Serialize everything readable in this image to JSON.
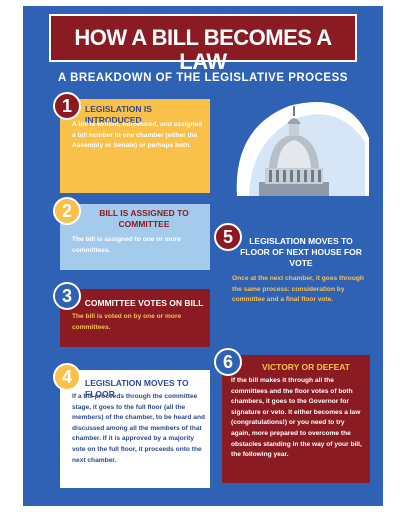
{
  "header": {
    "title": "HOW A BILL BECOMES A LAW",
    "subtitle": "A BREAKDOWN OF THE LEGISLATIVE PROCESS"
  },
  "colors": {
    "background_blue": "#2f62b4",
    "dark_red": "#8b1b23",
    "yellow": "#f9c04a",
    "light_blue": "#a4cbeb",
    "white": "#ffffff",
    "text_blue": "#2b4a93"
  },
  "steps": [
    {
      "number": "1",
      "heading": "LEGISLATION IS INTRODUCED",
      "text": "A bill is written, introduced, and assigned a bill number in one chamber (either the Assembly or Senate) or perhaps both."
    },
    {
      "number": "2",
      "heading": "BILL IS ASSIGNED TO COMMITTEE",
      "text": "The bill is assigned to one or more committees."
    },
    {
      "number": "3",
      "heading": "COMMITTEE VOTES ON BILL",
      "text": "The bill is voted on by one or more committees."
    },
    {
      "number": "4",
      "heading": "LEGISLATION MOVES TO FLOOR",
      "text": "If a bill proceeds through the committee stage, it goes to the full floor (all the members) of the chamber, to be heard and discussed among all the members of that chamber. If it is approved by a majority vote on the full floor, it proceeds onto the next chamber."
    },
    {
      "number": "5",
      "heading": "LEGISLATION MOVES TO FLOOR OF NEXT HOUSE FOR VOTE",
      "text": "Once at the next chamber, it goes through the same process: consideration by committee and a final floor vote."
    },
    {
      "number": "6",
      "heading": "VICTORY OR DEFEAT",
      "text": "If the bill makes it through all the committees and the floor votes of both chambers, it goes to the Governor for signature or veto. It either becomes a law (congratulations!) or you need to try again, more prepared to overcome the obstacles standing in the way of your bill, the following year."
    }
  ]
}
